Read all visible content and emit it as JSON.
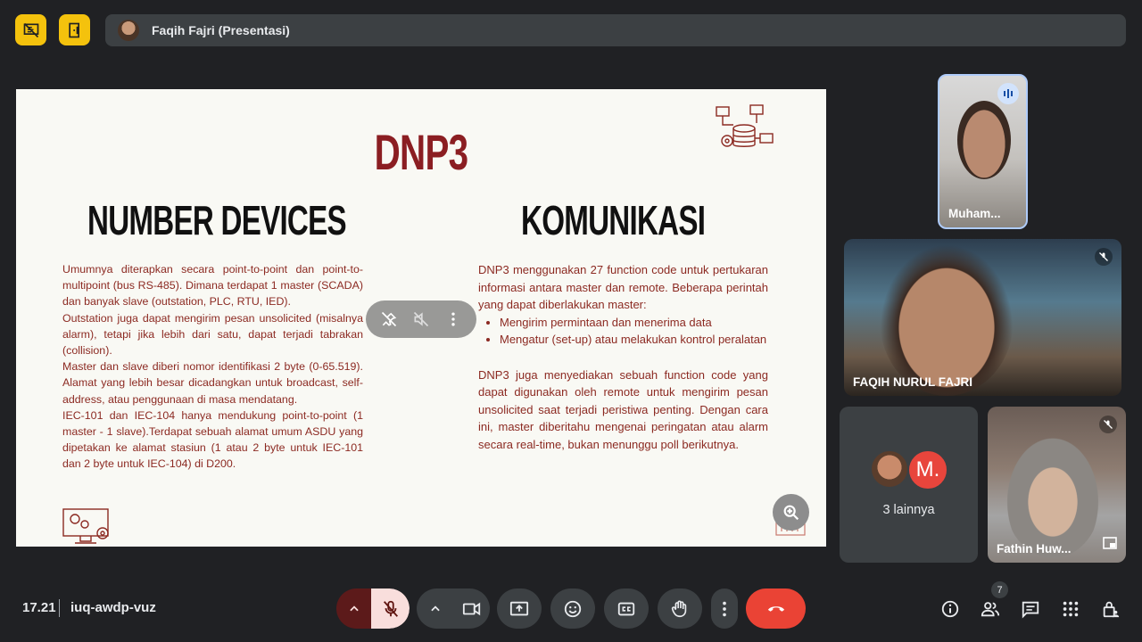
{
  "topbar": {
    "presenter_label": "Faqih Fajri (Presentasi)"
  },
  "slide": {
    "title": "DNP3",
    "left_heading": "NUMBER DEVICES",
    "left_paragraphs": [
      "Umumnya diterapkan secara point-to-point dan point-to-multipoint (bus RS-485). Dimana terdapat 1 master (SCADA) dan banyak slave (outstation, PLC, RTU, IED).",
      "Outstation juga dapat mengirim pesan unsolicited (misalnya alarm), tetapi jika lebih dari satu, dapat terjadi tabrakan (collision).",
      "Master dan slave diberi nomor identifikasi 2 byte (0-65.519). Alamat yang lebih besar dicadangkan untuk broadcast, self-address, atau penggunaan di masa mendatang.",
      "IEC-101 dan IEC-104 hanya mendukung point-to-point (1 master - 1 slave).Terdapat sebuah alamat umum ASDU yang dipetakan ke alamat stasiun (1 atau 2 byte untuk IEC-101 dan 2 byte untuk IEC-104) di D200."
    ],
    "right_heading": "KOMUNIKASI",
    "right_intro": "DNP3 menggunakan 27 function code untuk pertukaran informasi antara master dan remote. Beberapa perintah yang dapat diberlakukan master:",
    "right_bullets": [
      "Mengirim permintaan dan menerima data",
      "Mengatur (set-up) atau melakukan kontrol peralatan"
    ],
    "right_outro": "DNP3 juga menyediakan sebuah function code yang dapat digunakan oleh remote untuk mengirim pesan unsolicited saat terjadi peristiwa penting. Dengan cara ini, master diberitahu mengenai peringatan atau alarm secara real-time, bukan menunggu poll berikutnya."
  },
  "participants": {
    "tile1_name": "Muham...",
    "tile2_name": "FAQIH NURUL FAJRI",
    "others_avatar_letter": "M.",
    "others_label": "3 lainnya",
    "tile4_name": "Fathin Huw..."
  },
  "bottombar": {
    "time": "17.21",
    "meeting_code": "iuq-awdp-vuz",
    "people_count": "7"
  },
  "colors": {
    "accent_yellow": "#f4c20d",
    "end_call_red": "#ea4335",
    "mic_off_bg": "#f9dedc",
    "slide_title": "#8b1e22",
    "slide_text": "#8c2a22"
  }
}
